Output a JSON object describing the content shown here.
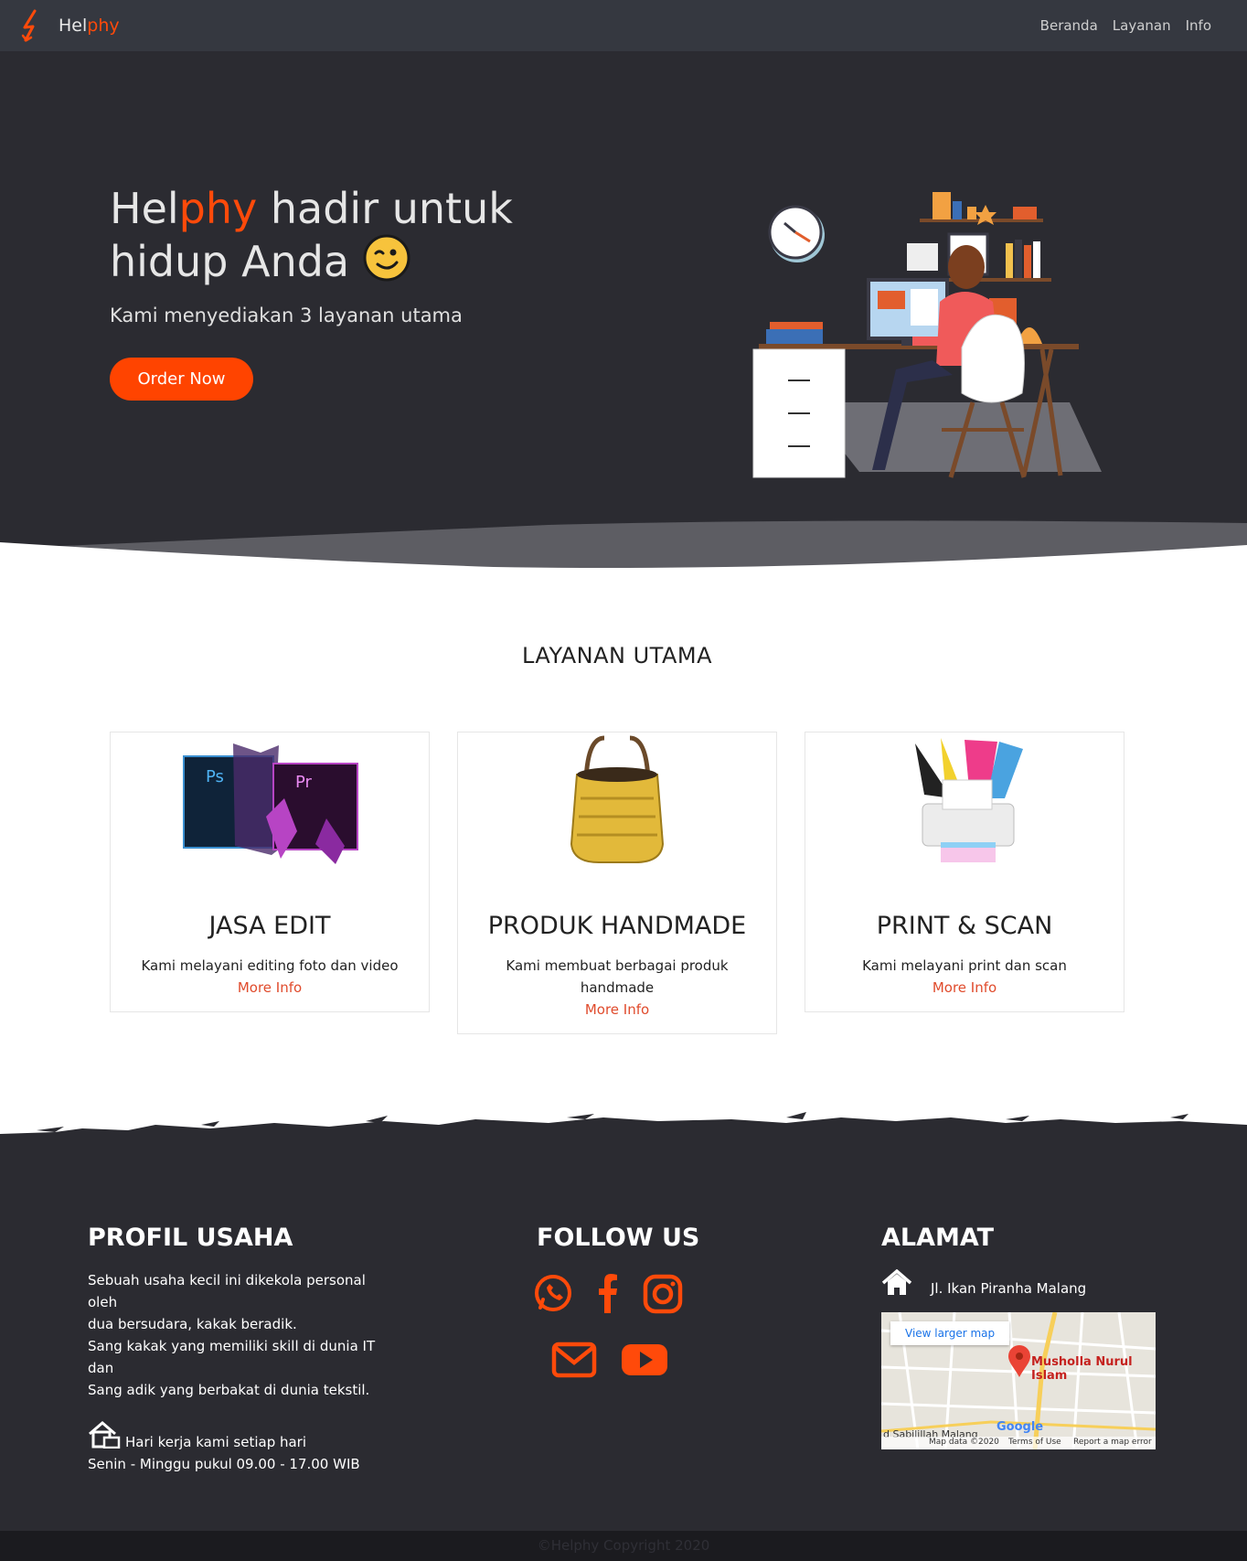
{
  "nav": {
    "brand_a": "Hel",
    "brand_b": "phy",
    "links": [
      "Beranda",
      "Layanan",
      "Info"
    ]
  },
  "hero": {
    "title_a": "Hel",
    "title_b": "phy",
    "title_c": " hadir untuk hidup Anda ",
    "subtitle": "Kami menyediakan 3 layanan utama",
    "cta": "Order Now"
  },
  "services": {
    "heading": "LAYANAN UTAMA",
    "items": [
      {
        "title": "JASA EDIT",
        "desc": "Kami melayani editing foto dan video",
        "link": "More Info",
        "icon": "adobe-ps-pr-icon"
      },
      {
        "title": "PRODUK HANDMADE",
        "desc": "Kami membuat berbagai produk handmade",
        "link": "More Info",
        "icon": "handbag-icon"
      },
      {
        "title": "PRINT & SCAN",
        "desc": "Kami melayani print dan scan",
        "link": "More Info",
        "icon": "printer-icon"
      }
    ]
  },
  "footer": {
    "profil": {
      "heading": "PROFIL USAHA",
      "line1": "Sebuah usaha kecil ini dikekola personal",
      "line2": "oleh",
      "line3": "dua bersudara, kakak beradik.",
      "line4": "Sang kakak yang memiliki skill di dunia IT",
      "line5": "dan",
      "line6": "Sang adik yang berbakat di dunia tekstil.",
      "hours1": "Hari kerja kami setiap hari",
      "hours2": "Senin - Minggu pukul 09.00 - 17.00 WIB"
    },
    "follow": {
      "heading": "FOLLOW US",
      "icons": [
        "whatsapp-icon",
        "facebook-icon",
        "instagram-icon",
        "mail-icon",
        "youtube-icon"
      ]
    },
    "alamat": {
      "heading": "ALAMAT",
      "address": "Jl. Ikan Piranha Malang",
      "map_button": "View larger map",
      "map_place": "Musholla Nurul Islam",
      "map_data": "Map data ©2020",
      "map_terms": "Terms of Use",
      "map_report": "Report a map error",
      "map_road": "d Sabilillah Malang",
      "map_logo": "Google"
    },
    "copyright": "©Helphy Copyright 2020"
  },
  "colors": {
    "accent": "#ff4a0a",
    "nav_bg": "#353840",
    "dark_bg": "#2b2b31",
    "link": "#e04b2c"
  }
}
